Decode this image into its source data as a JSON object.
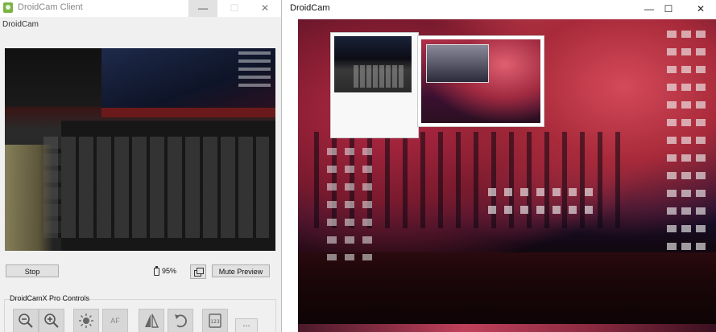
{
  "left_window": {
    "title": "DroidCam Client",
    "controls": {
      "minimize": "—",
      "maximize": "☐",
      "close": "✕"
    },
    "header_label": "DroidCam",
    "stop_label": "Stop",
    "battery": "95%",
    "mute_label": "Mute Preview",
    "pro_controls_label": "DroidCamX Pro Controls",
    "tools": [
      {
        "name": "zoom-out-icon"
      },
      {
        "name": "zoom-in-icon"
      },
      {
        "name": "brightness-icon"
      },
      {
        "name": "autofocus-button",
        "label": "AF"
      },
      {
        "name": "flip-icon"
      },
      {
        "name": "rotate-icon"
      },
      {
        "name": "counter-icon"
      },
      {
        "name": "more-button",
        "label": "..."
      }
    ]
  },
  "right_window": {
    "title": "DroidCam",
    "controls": {
      "minimize": "—",
      "maximize": "☐",
      "close": "✕"
    }
  }
}
